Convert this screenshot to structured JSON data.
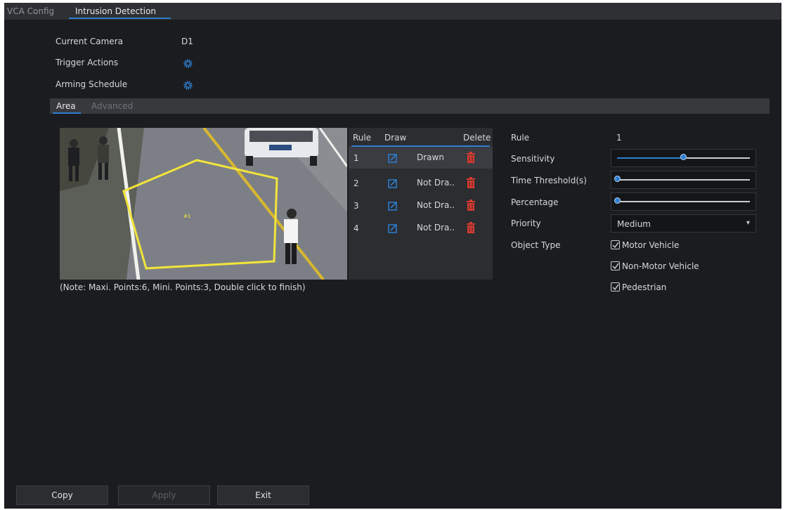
{
  "tabs": {
    "vca_config": "VCA Config",
    "intrusion_detection": "Intrusion Detection"
  },
  "settings": {
    "current_camera_label": "Current Camera",
    "current_camera_value": "D1",
    "trigger_actions_label": "Trigger Actions",
    "arming_schedule_label": "Arming Schedule"
  },
  "subtabs": {
    "area": "Area",
    "advanced": "Advanced"
  },
  "video": {
    "region_label": "#1"
  },
  "rules_table": {
    "headers": {
      "rule": "Rule",
      "draw": "Draw",
      "delete": "Delete"
    },
    "rows": [
      {
        "rule": "1",
        "status": "Drawn"
      },
      {
        "rule": "2",
        "status": "Not Dra.."
      },
      {
        "rule": "3",
        "status": "Not Dra.."
      },
      {
        "rule": "4",
        "status": "Not Dra.."
      }
    ]
  },
  "note": "(Note: Maxi. Points:6, Mini. Points:3, Double click to finish)",
  "config": {
    "rule_label": "Rule",
    "rule_value": "1",
    "sensitivity_label": "Sensitivity",
    "sensitivity_level": 0.5,
    "time_threshold_label": "Time Threshold(s)",
    "time_threshold_level": 0.0,
    "percentage_label": "Percentage",
    "percentage_level": 0.0,
    "priority_label": "Priority",
    "priority_value": "Medium",
    "object_type_label": "Object Type",
    "object_types": [
      {
        "label": "Motor Vehicle",
        "checked": true
      },
      {
        "label": "Non-Motor Vehicle",
        "checked": true
      },
      {
        "label": "Pedestrian",
        "checked": true
      }
    ]
  },
  "buttons": {
    "copy": "Copy",
    "apply": "Apply",
    "exit": "Exit"
  },
  "colors": {
    "accent": "#2d7fd1",
    "delete": "#d93a30",
    "region": "#f2e43a"
  },
  "icons": {
    "trigger": "gear-icon",
    "schedule": "gear-icon",
    "draw": "edit-icon",
    "delete": "trash-icon"
  }
}
